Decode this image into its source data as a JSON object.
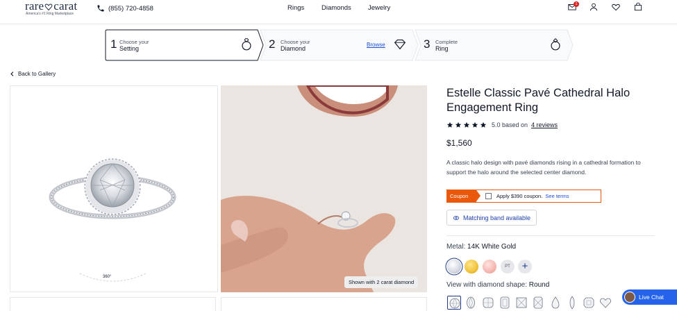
{
  "header": {
    "logo_main_a": "rare",
    "logo_main_b": "carat",
    "logo_tagline": "America's #1 Ring Marketplace",
    "phone": "(855) 720-4858",
    "nav": [
      "Rings",
      "Diamonds",
      "Jewelry"
    ],
    "mail_badge": "1"
  },
  "steps": [
    {
      "number": "1",
      "small": "Choose your",
      "big": "Setting"
    },
    {
      "number": "2",
      "small": "Choose your",
      "big": "Diamond",
      "link": "Browse"
    },
    {
      "number": "3",
      "small": "Complete",
      "big": "Ring"
    }
  ],
  "back_link": "Back to Gallery",
  "gallery": {
    "spin_label": "360°",
    "shown_badge": "Shown with 2 carat diamond"
  },
  "product": {
    "title": "Estelle Classic Pavé Cathedral Halo Engagement Ring",
    "rating_value": 5,
    "rating_text": "5.0 based on",
    "reviews_link": "4 reviews",
    "price": "$1,560",
    "description": "A classic halo design with pavé diamonds rising in a cathedral formation to support the halo around the selected center diamond."
  },
  "coupon": {
    "tag": "Coupon",
    "text": "Apply $390 coupon.",
    "link": "See terms"
  },
  "matching_band": "Matching band available",
  "metal": {
    "label": "Metal:",
    "selected": "14K White Gold",
    "swatches": [
      {
        "name": "white-gold",
        "color": "#e8eaf0"
      },
      {
        "name": "yellow-gold",
        "color": "#f2c23a"
      },
      {
        "name": "rose-gold",
        "color": "#f4b6b0"
      },
      {
        "name": "platinum",
        "label": "PT"
      }
    ],
    "more": "+"
  },
  "shape": {
    "label": "View with diamond shape:",
    "selected": "Round"
  },
  "live_chat": "Live Chat",
  "colors": {
    "accent_blue": "#1e3a8a",
    "link_blue": "#1d4ed8",
    "coupon_orange": "#ea580c",
    "chat_blue": "#2563eb"
  }
}
